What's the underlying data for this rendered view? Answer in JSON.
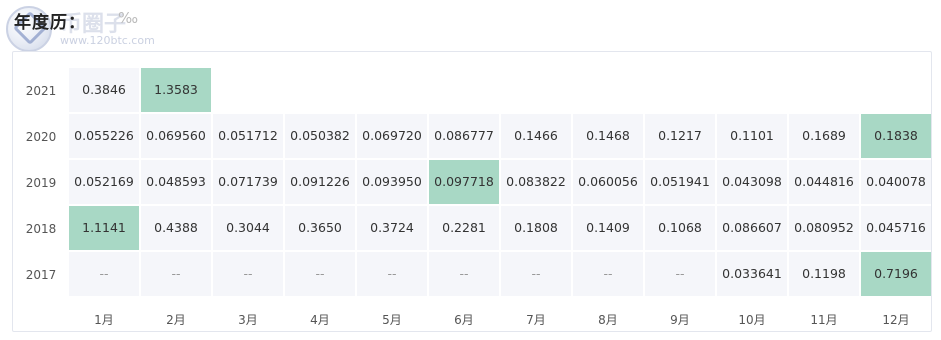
{
  "header": {
    "title": "年度历：",
    "title_suffix": "‰"
  },
  "watermark": {
    "logo_text": "币圈子",
    "logo_url": "www.120btc.com"
  },
  "table": {
    "months": [
      "1月",
      "2月",
      "3月",
      "4月",
      "5月",
      "6月",
      "7月",
      "8月",
      "9月",
      "10月",
      "11月",
      "12月"
    ],
    "rows": [
      {
        "year": "2021",
        "cells": [
          {
            "v": "0.3846",
            "hl": false
          },
          {
            "v": "1.3583",
            "hl": true
          },
          {
            "v": "",
            "hl": false
          },
          {
            "v": "",
            "hl": false
          },
          {
            "v": "",
            "hl": false
          },
          {
            "v": "",
            "hl": false
          },
          {
            "v": "",
            "hl": false
          },
          {
            "v": "",
            "hl": false
          },
          {
            "v": "",
            "hl": false
          },
          {
            "v": "",
            "hl": false
          },
          {
            "v": "",
            "hl": false
          },
          {
            "v": "",
            "hl": false
          }
        ]
      },
      {
        "year": "2020",
        "cells": [
          {
            "v": "0.055226",
            "hl": false
          },
          {
            "v": "0.069560",
            "hl": false
          },
          {
            "v": "0.051712",
            "hl": false
          },
          {
            "v": "0.050382",
            "hl": false
          },
          {
            "v": "0.069720",
            "hl": false
          },
          {
            "v": "0.086777",
            "hl": false
          },
          {
            "v": "0.1466",
            "hl": false
          },
          {
            "v": "0.1468",
            "hl": false
          },
          {
            "v": "0.1217",
            "hl": false
          },
          {
            "v": "0.1101",
            "hl": false
          },
          {
            "v": "0.1689",
            "hl": false
          },
          {
            "v": "0.1838",
            "hl": true
          }
        ]
      },
      {
        "year": "2019",
        "cells": [
          {
            "v": "0.052169",
            "hl": false
          },
          {
            "v": "0.048593",
            "hl": false
          },
          {
            "v": "0.071739",
            "hl": false
          },
          {
            "v": "0.091226",
            "hl": false
          },
          {
            "v": "0.093950",
            "hl": false
          },
          {
            "v": "0.097718",
            "hl": true
          },
          {
            "v": "0.083822",
            "hl": false
          },
          {
            "v": "0.060056",
            "hl": false
          },
          {
            "v": "0.051941",
            "hl": false
          },
          {
            "v": "0.043098",
            "hl": false
          },
          {
            "v": "0.044816",
            "hl": false
          },
          {
            "v": "0.040078",
            "hl": false
          }
        ]
      },
      {
        "year": "2018",
        "cells": [
          {
            "v": "1.1141",
            "hl": true
          },
          {
            "v": "0.4388",
            "hl": false
          },
          {
            "v": "0.3044",
            "hl": false
          },
          {
            "v": "0.3650",
            "hl": false
          },
          {
            "v": "0.3724",
            "hl": false
          },
          {
            "v": "0.2281",
            "hl": false
          },
          {
            "v": "0.1808",
            "hl": false
          },
          {
            "v": "0.1409",
            "hl": false
          },
          {
            "v": "0.1068",
            "hl": false
          },
          {
            "v": "0.086607",
            "hl": false
          },
          {
            "v": "0.080952",
            "hl": false
          },
          {
            "v": "0.045716",
            "hl": false
          }
        ]
      },
      {
        "year": "2017",
        "cells": [
          {
            "v": "--",
            "hl": false
          },
          {
            "v": "--",
            "hl": false
          },
          {
            "v": "--",
            "hl": false
          },
          {
            "v": "--",
            "hl": false
          },
          {
            "v": "--",
            "hl": false
          },
          {
            "v": "--",
            "hl": false
          },
          {
            "v": "--",
            "hl": false
          },
          {
            "v": "--",
            "hl": false
          },
          {
            "v": "--",
            "hl": false
          },
          {
            "v": "0.033641",
            "hl": false
          },
          {
            "v": "0.1198",
            "hl": false
          },
          {
            "v": "0.7196",
            "hl": true
          }
        ]
      }
    ]
  }
}
